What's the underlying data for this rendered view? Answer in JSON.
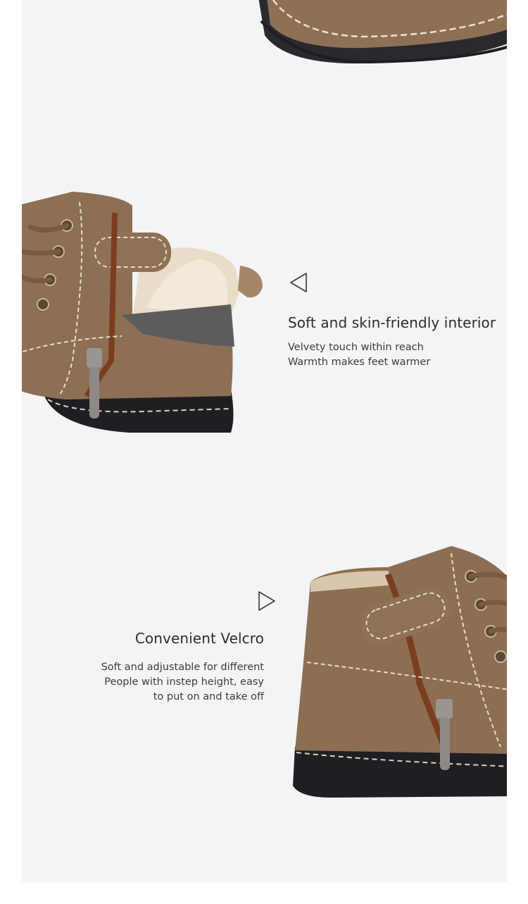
{
  "features": [
    {
      "title": "Soft and skin-friendly interior",
      "lines": [
        "Velvety touch within reach",
        "Warmth makes feet warmer"
      ]
    },
    {
      "title": "Convenient Velcro",
      "lines": [
        "Soft and adjustable for different",
        "People with instep height, easy",
        "to put on and take off"
      ]
    }
  ],
  "colors": {
    "background": "#f3f4f6",
    "suede": "#8c6e52",
    "sole": "#2a2a2e",
    "stitching": "#e8dcc6",
    "text": "#2d2d2f"
  },
  "icons": [
    "triangle-left-icon",
    "triangle-right-icon"
  ]
}
